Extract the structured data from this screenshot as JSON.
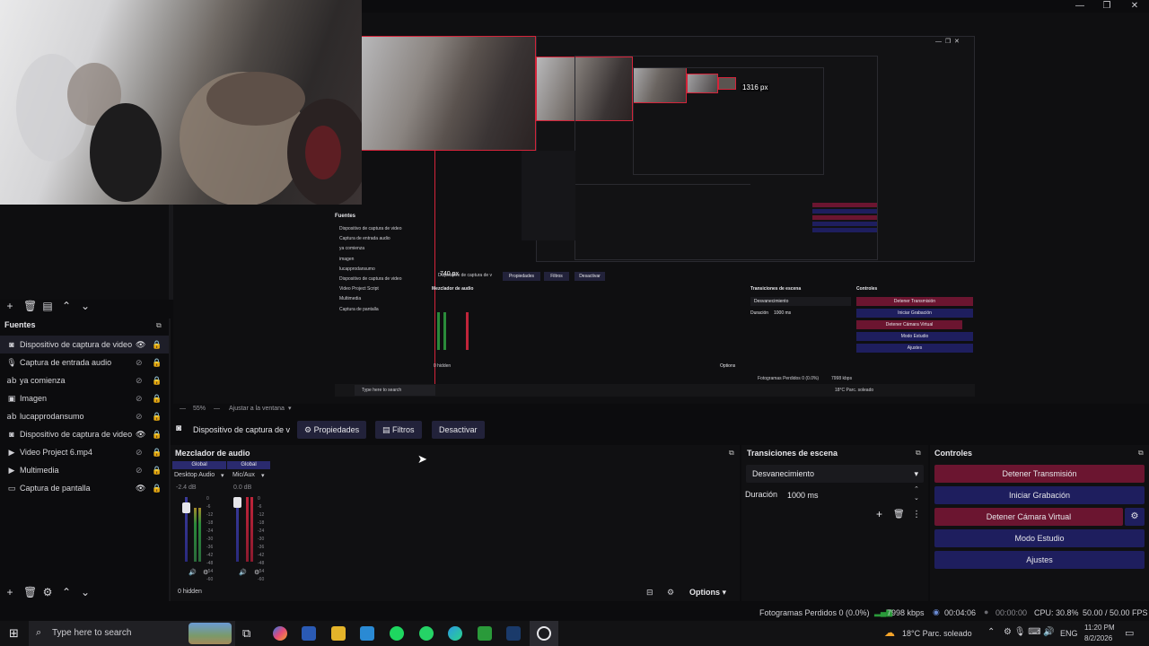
{
  "window": {
    "minimize": "—",
    "maximize": "❐",
    "close": "✕"
  },
  "nested_preview": {
    "measure_width": "1316 px",
    "measure_height": "740 px",
    "inner_sources_title": "Fuentes",
    "inner_sources": [
      "Dispositivo de captura de video",
      "Captura de entrada audio",
      "ya comienza",
      "imagen",
      "lucapprodansumo",
      "Dispositivo de captura de video",
      "Video Project Script",
      "Multimedia",
      "Captura de pantalla"
    ],
    "inner_filter": [
      "Dispositivo de captura de v",
      "Propiedades",
      "Filtros",
      "Desactivar"
    ],
    "inner_mixer_title": "Mezclador de audio",
    "inner_transitions_title": "Transiciones de escena",
    "inner_transition": "Desvanecimiento",
    "inner_duration_label": "Duración",
    "inner_duration": "1000 ms",
    "inner_controls_title": "Controles",
    "inner_controls": [
      "Detener Transmisión",
      "Iniciar Grabación",
      "Detener Cámara Virtual",
      "Modo Estudio",
      "Ajustes"
    ],
    "inner_options": "Options",
    "inner_hidden": "0 hidden",
    "inner_status": "Fotogramas Perdidos 0 (0.0%)",
    "inner_kbps": "7998 kbps",
    "inner_search": "Type here to search",
    "inner_weather": "18°C Parc. soleado"
  },
  "zoombar": {
    "zoom": "55%",
    "fit": "Ajustar a la ventana"
  },
  "sources": {
    "title": "Fuentes",
    "items": [
      {
        "label": "Dispositivo de captura de video",
        "icon": "camera-icon"
      },
      {
        "label": "Captura de entrada audio",
        "icon": "microphone-icon"
      },
      {
        "label": "ya comienza",
        "icon": "text-icon"
      },
      {
        "label": "Imagen",
        "icon": "image-icon"
      },
      {
        "label": "lucapprodansumo",
        "icon": "text-icon"
      },
      {
        "label": "Dispositivo de captura de video",
        "icon": "camera-icon"
      },
      {
        "label": "Video Project 6.mp4",
        "icon": "play-icon"
      },
      {
        "label": "Multimedia",
        "icon": "play-icon"
      },
      {
        "label": "Captura de pantalla",
        "icon": "monitor-icon"
      }
    ]
  },
  "filterbar": {
    "source_name": "Dispositivo de captura de v",
    "properties": "Propiedades",
    "filters": "Filtros",
    "deactivate": "Desactivar"
  },
  "mixer": {
    "title": "Mezclador de audio",
    "tracks": [
      {
        "head": "Global",
        "name": "Desktop Audio",
        "db": "-2.4 dB"
      },
      {
        "head": "Global",
        "name": "Mic/Aux",
        "db": "0.0 dB"
      }
    ],
    "ticks": [
      "0",
      "-6",
      "-12",
      "-18",
      "-24",
      "-30",
      "-36",
      "-42",
      "-48",
      "-54",
      "-60"
    ],
    "hidden": "0 hidden",
    "options": "Options"
  },
  "transitions": {
    "title": "Transiciones de escena",
    "selected": "Desvanecimiento",
    "duration_label": "Duración",
    "duration": "1000 ms"
  },
  "controls": {
    "title": "Controles",
    "stop_stream": "Detener Transmisión",
    "start_record": "Iniciar Grabación",
    "stop_virtualcam": "Detener Cámara Virtual",
    "studio_mode": "Modo Estudio",
    "settings": "Ajustes"
  },
  "status": {
    "dropped": "Fotogramas Perdidos 0 (0.0%)",
    "kbps": "7998 kbps",
    "stream_time": "00:04:06",
    "record_time": "00:00:00",
    "cpu": "CPU: 30.8%",
    "fps": "50.00 / 50.00 FPS"
  },
  "taskbar": {
    "search_placeholder": "Type here to search",
    "weather": "18°C  Parc. soleado",
    "lang": "ENG",
    "time": "11:20 PM",
    "date": "8/2/2026"
  },
  "colors": {
    "accent_blue": "#1e1e5e",
    "accent_red": "#6b1530",
    "selection_red": "#d4243a"
  }
}
